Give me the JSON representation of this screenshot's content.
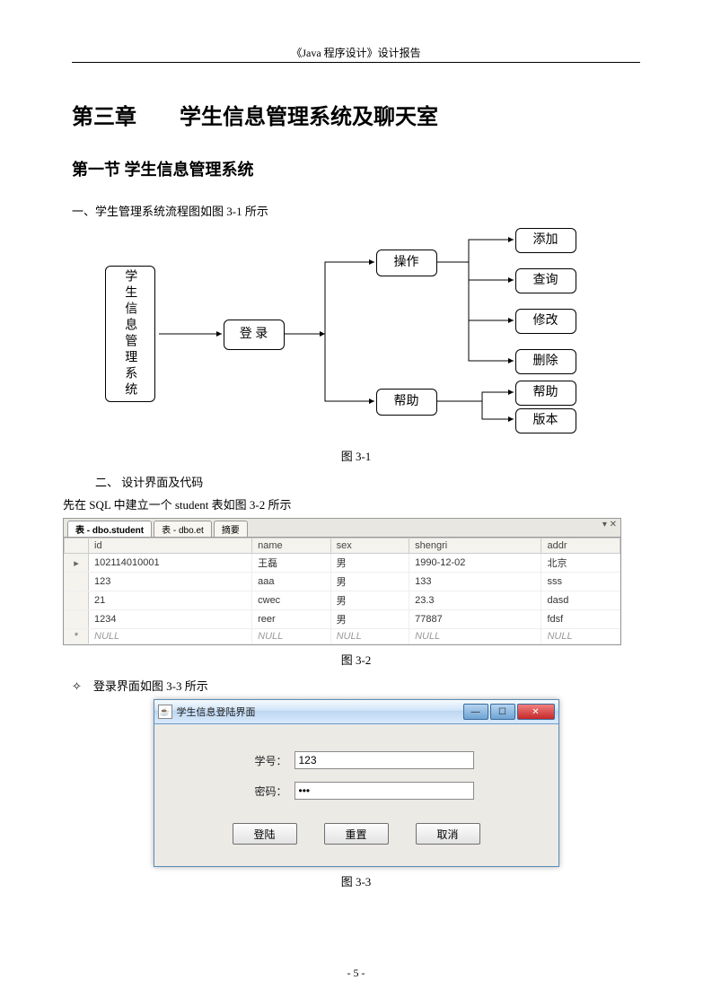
{
  "header": "《Java 程序设计》设计报告",
  "chapter": "第三章　　学生信息管理系统及聊天室",
  "section": "第一节 学生信息管理系统",
  "intro1": "一、学生管理系统流程图如图 3-1 所示",
  "flow": {
    "root": "学生信息管理系统",
    "login": "登 录",
    "op": "操作",
    "help": "帮助",
    "add": "添加",
    "query": "查询",
    "modify": "修改",
    "delete": "删除",
    "help2": "帮助",
    "version": "版本"
  },
  "cap1": "图 3-1",
  "intro2": "二、 设计界面及代码",
  "intro2b": "先在 SQL 中建立一个 student 表如图 3-2 所示",
  "sqltabs": {
    "tab1": "表 - dbo.student",
    "tab2": "表 - dbo.et",
    "tab3": "摘要"
  },
  "table": {
    "cols": [
      "id",
      "name",
      "sex",
      "shengri",
      "addr"
    ],
    "rows": [
      [
        "102114010001",
        "王磊",
        "男",
        "1990-12-02",
        "北京"
      ],
      [
        "123",
        "aaa",
        "男",
        "133",
        "sss"
      ],
      [
        "21",
        "cwec",
        "男",
        "23.3",
        "dasd"
      ],
      [
        "1234",
        "reer",
        "男",
        "77887",
        "fdsf"
      ],
      [
        "NULL",
        "NULL",
        "NULL",
        "NULL",
        "NULL"
      ]
    ]
  },
  "cap2": "图 3-2",
  "intro3": "✧　登录界面如图 3-3 所示",
  "login": {
    "title": "学生信息登陆界面",
    "lbl_id": "学号：",
    "lbl_pw": "密码：",
    "val_id": "123",
    "val_pw": "•••",
    "btn_login": "登陆",
    "btn_reset": "重置",
    "btn_cancel": "取消"
  },
  "cap3": "图 3-3",
  "pagenum": "- 5 -"
}
